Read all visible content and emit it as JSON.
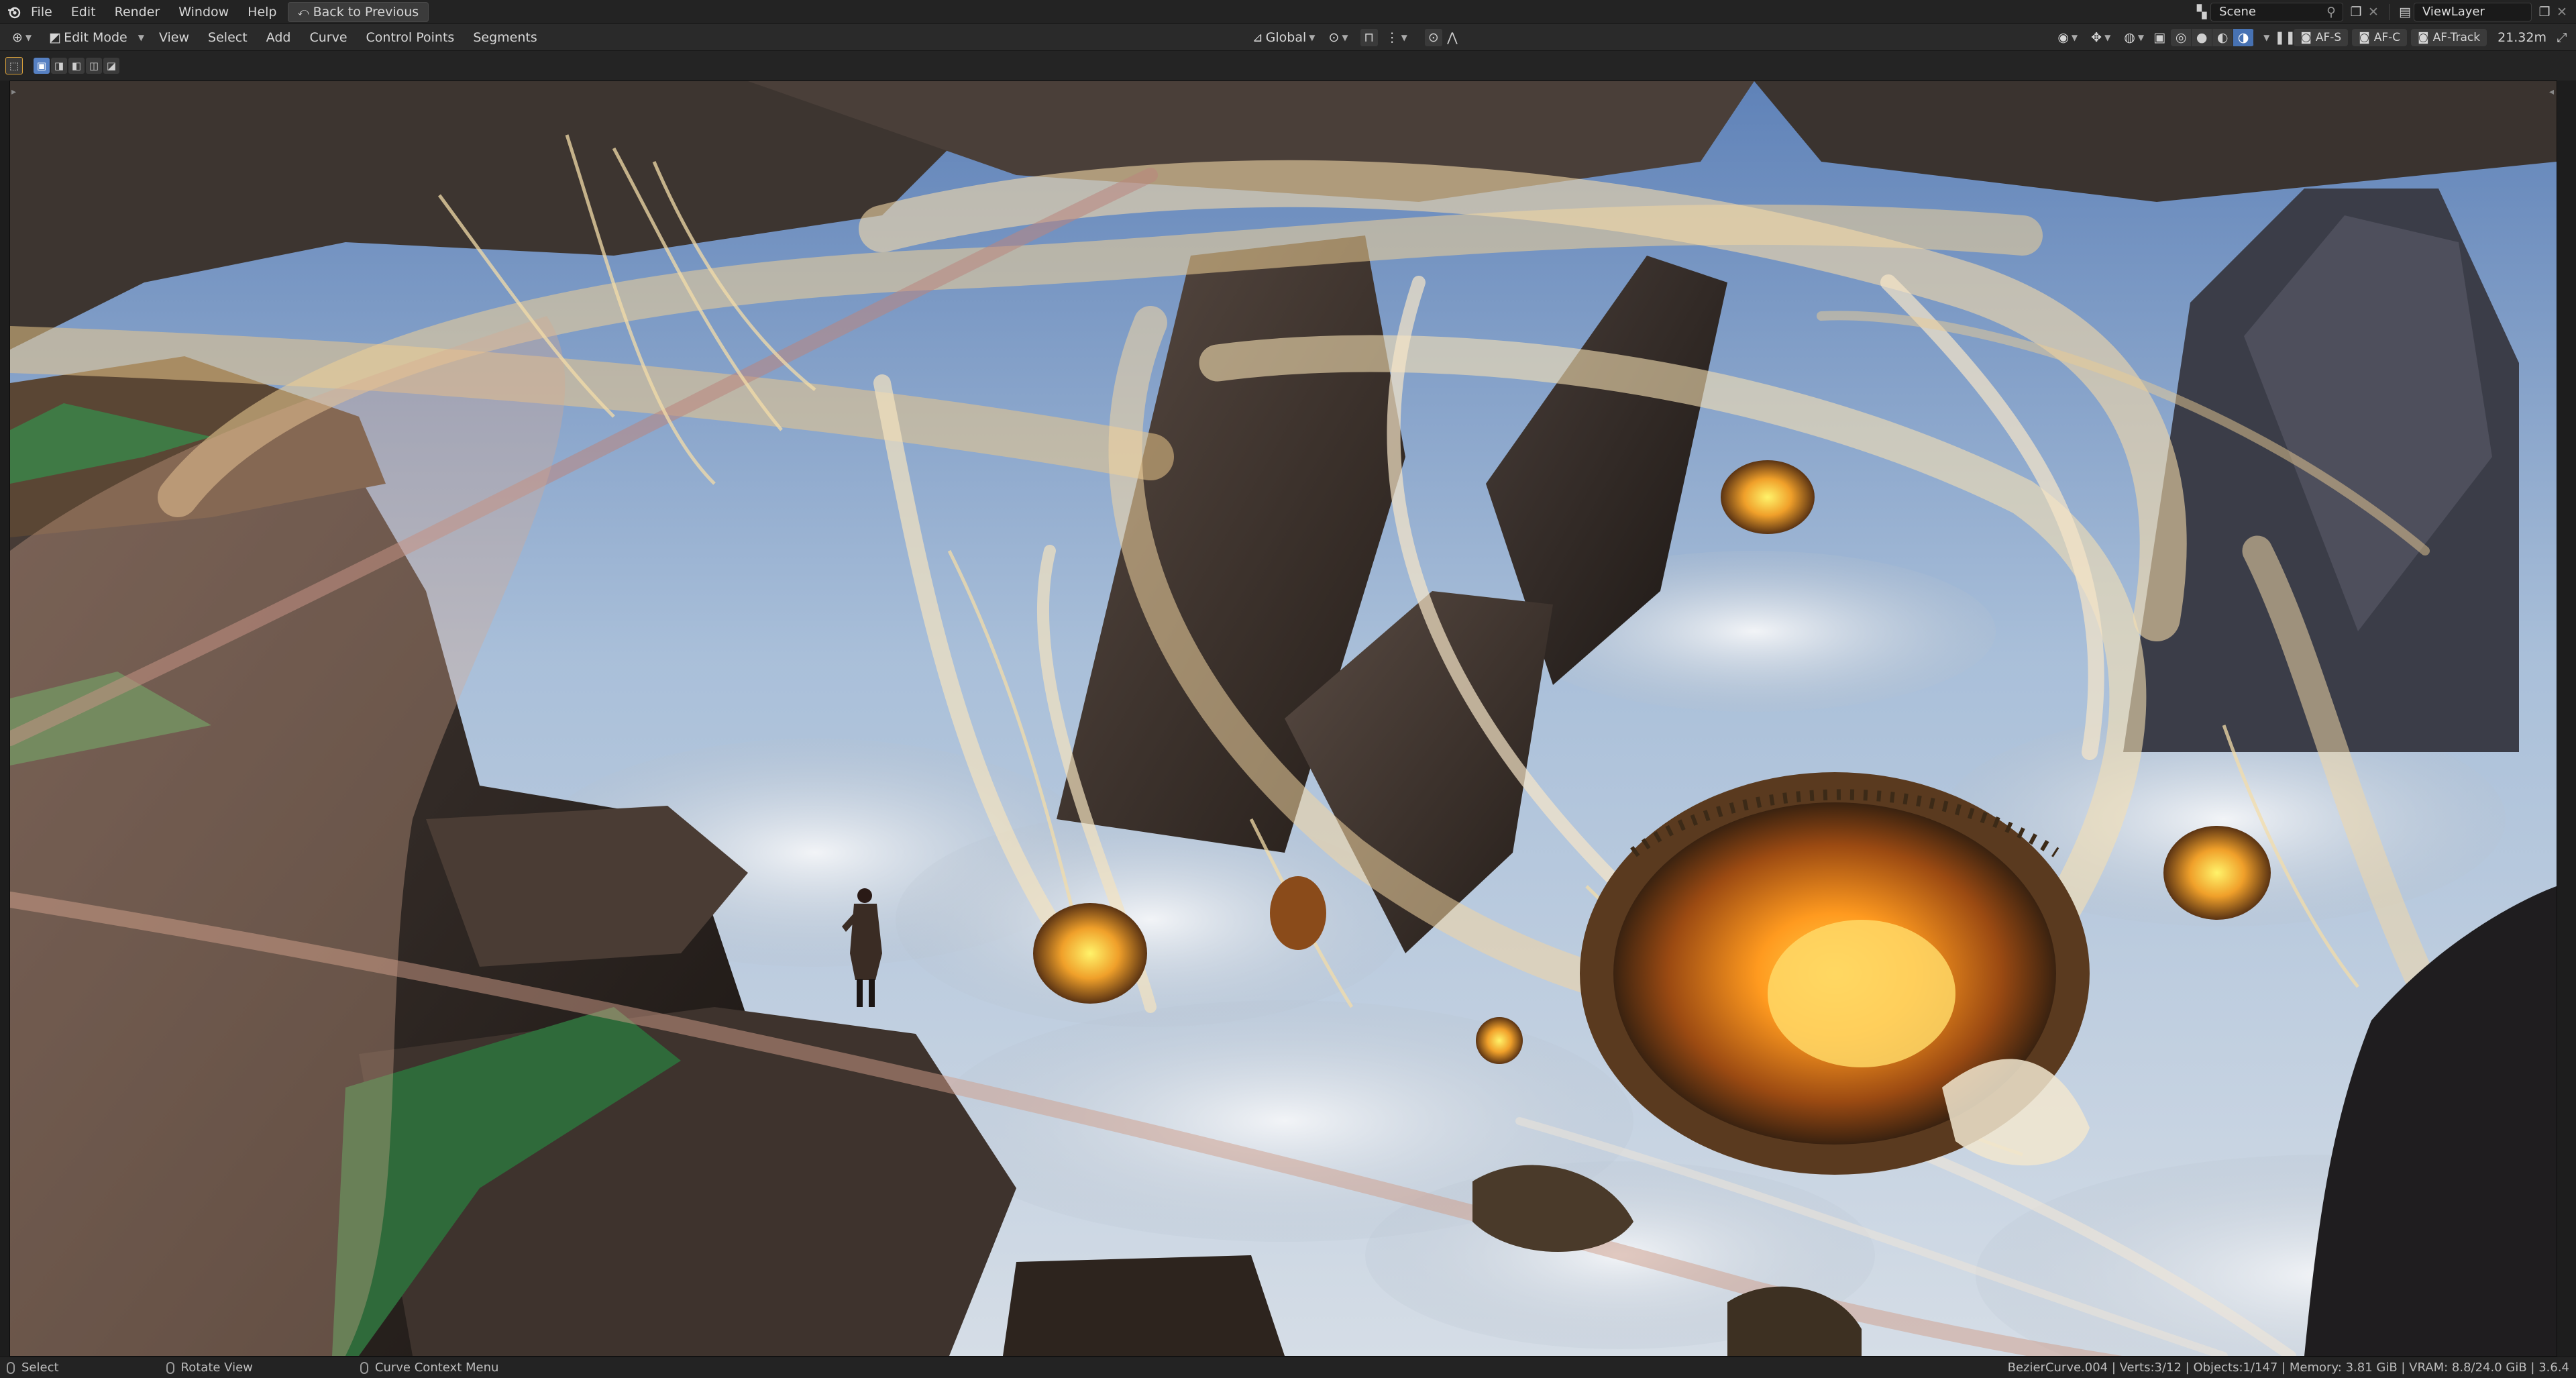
{
  "topbar": {
    "menus": [
      "File",
      "Edit",
      "Render",
      "Window",
      "Help"
    ],
    "back_button": "Back to Previous",
    "scene_value": "Scene",
    "viewlayer_value": "ViewLayer"
  },
  "header": {
    "mode": "Edit Mode",
    "menus": [
      "View",
      "Select",
      "Add",
      "Curve",
      "Control Points",
      "Segments"
    ],
    "orientation": "Global",
    "af_buttons": [
      "AF-S",
      "AF-C",
      "AF-Track"
    ],
    "distance": "21.32m"
  },
  "statusbar": {
    "items": [
      "Select",
      "Rotate View",
      "Curve Context Menu"
    ],
    "info": "BezierCurve.004 | Verts:3/12 | Objects:1/147 | Memory: 3.81 GiB | VRAM: 8.8/24.0 GiB | 3.6.4"
  },
  "icons": {
    "app": "blender-icon",
    "back": "back-icon",
    "scene": "scene-icon",
    "viewlayer": "viewlayer-icon"
  },
  "colors": {
    "accent": "#4772b3",
    "bar": "#232323",
    "header": "#2a2a2a"
  }
}
